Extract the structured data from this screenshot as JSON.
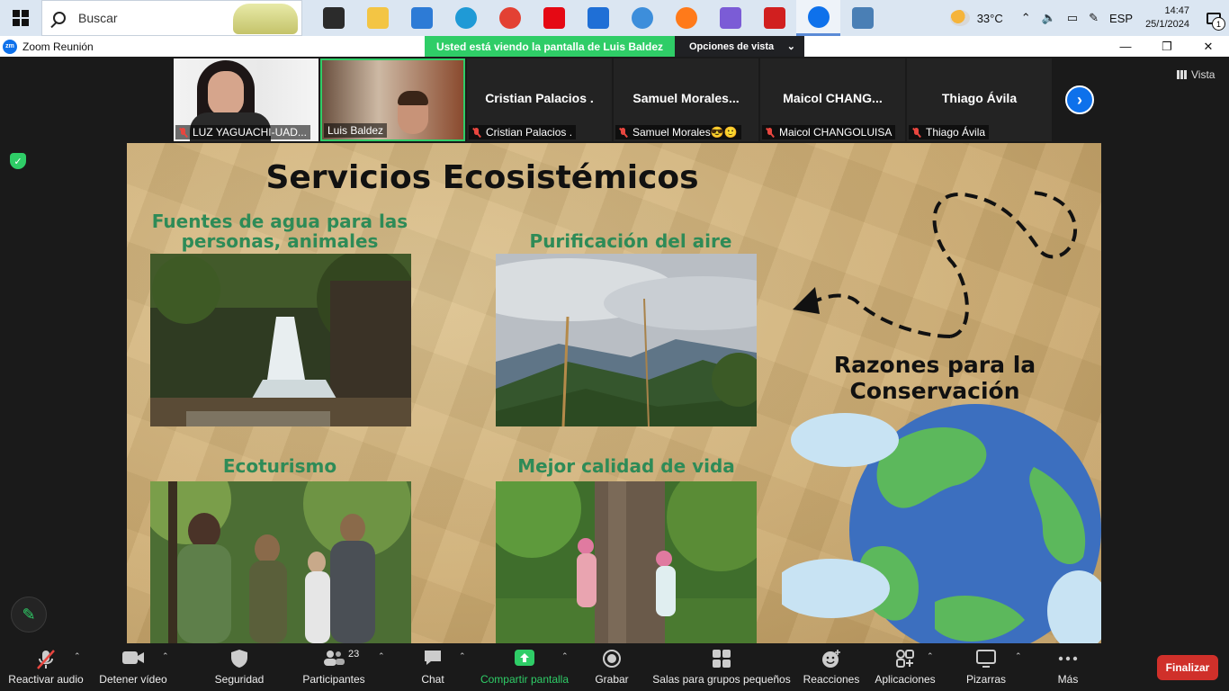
{
  "taskbar": {
    "search_placeholder": "Buscar",
    "apps": [
      {
        "name": "task-view-icon",
        "color": "#2b2b2b"
      },
      {
        "name": "file-explorer-icon",
        "color": "#f3c544"
      },
      {
        "name": "microsoft-store-icon",
        "color": "#2d7bd6"
      },
      {
        "name": "edge-icon",
        "color": "#1f9ad6"
      },
      {
        "name": "chrome-icon",
        "color": "#e34133"
      },
      {
        "name": "netflix-icon",
        "color": "#e50914"
      },
      {
        "name": "mail-icon",
        "color": "#1f6fd6"
      },
      {
        "name": "search-app-icon",
        "color": "#3d8edb"
      },
      {
        "name": "firefox-icon",
        "color": "#ff7a1a"
      },
      {
        "name": "app-icon",
        "color": "#7b5cd6"
      },
      {
        "name": "acrobat-icon",
        "color": "#d11f1f"
      },
      {
        "name": "zoom-icon",
        "color": "#0e71eb"
      },
      {
        "name": "remote-desktop-icon",
        "color": "#4a7fb5"
      }
    ],
    "temperature": "33°C",
    "language": "ESP",
    "time": "14:47",
    "date": "25/1/2024",
    "notification_count": "1"
  },
  "window": {
    "title": "Zoom Reunión",
    "share_banner": "Usted está viendo la pantalla de  Luis Baldez",
    "view_options": "Opciones de vista"
  },
  "participants": [
    {
      "label": "LUZ YAGUACHI-UAD...",
      "muted": true,
      "video": true
    },
    {
      "label": "Luis Baldez",
      "muted": false,
      "video": true
    },
    {
      "center": "Cristian Palacios .",
      "label": "Cristian Palacios .",
      "muted": true
    },
    {
      "center": "Samuel  Morales...",
      "label": "Samuel Morales😎🙂",
      "muted": true
    },
    {
      "center": "Maicol   CHANG...",
      "label": "Maicol  CHANGOLUISA",
      "muted": true
    },
    {
      "center": "Thiago Ávila",
      "label": "Thiago Ávila",
      "muted": true
    }
  ],
  "view_label": "Vista",
  "slide": {
    "title": "Servicios Ecosistémicos",
    "sections": [
      "Fuentes de agua para las personas, animales",
      "Purificación del aire",
      "Ecoturismo",
      "Mejor calidad de vida"
    ],
    "razones": "Razones para la Conservación"
  },
  "toolbar": {
    "audio": "Reactivar audio",
    "video": "Detener vídeo",
    "security": "Seguridad",
    "participants": "Participantes",
    "participants_count": "23",
    "chat": "Chat",
    "share": "Compartir pantalla",
    "record": "Grabar",
    "breakout": "Salas para grupos pequeños",
    "reactions": "Reacciones",
    "apps": "Aplicaciones",
    "whiteboards": "Pizarras",
    "more": "Más",
    "end": "Finalizar"
  }
}
